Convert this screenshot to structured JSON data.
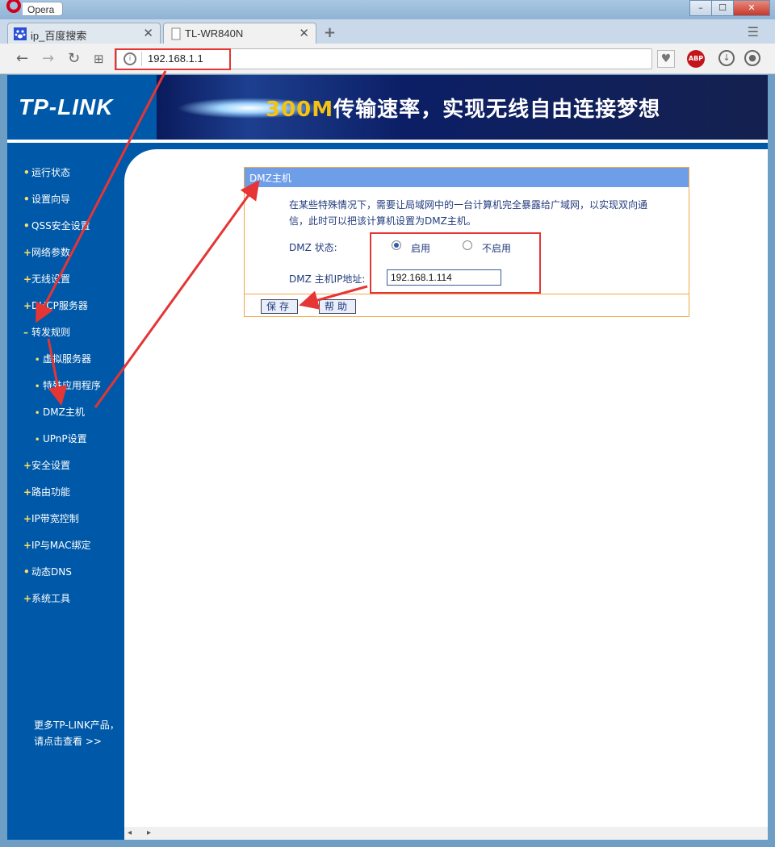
{
  "browser": {
    "app_name": "Opera",
    "tabs": [
      {
        "label": "ip_百度搜索",
        "close": "✕"
      },
      {
        "label": "TL-WR840N",
        "close": "✕"
      }
    ],
    "new_tab": "+",
    "tab_menu": "☰",
    "nav": {
      "back": "←",
      "forward": "→",
      "reload": "↻",
      "grid": "⊞"
    },
    "address": "192.168.1.1",
    "heart": "♥",
    "abp": "ABP",
    "download": "↓",
    "account": "●",
    "win": {
      "min": "–",
      "max": "☐",
      "close": "✕"
    }
  },
  "banner": {
    "logo": "TP-LINK",
    "slogan_highlight": "300M",
    "slogan_rest": "传输速率，实现无线自由连接梦想"
  },
  "sidebar": {
    "items": [
      {
        "label": "运行状态",
        "bullet": "•"
      },
      {
        "label": "设置向导",
        "bullet": "•"
      },
      {
        "label": "QSS安全设置",
        "bullet": "•"
      },
      {
        "label": "网络参数",
        "bullet": "+"
      },
      {
        "label": "无线设置",
        "bullet": "+"
      },
      {
        "label": "DHCP服务器",
        "bullet": "+"
      },
      {
        "label": "转发规则",
        "bullet": "–"
      },
      {
        "label": "虚拟服务器",
        "bullet": "•"
      },
      {
        "label": "特殊应用程序",
        "bullet": "•"
      },
      {
        "label": "DMZ主机",
        "bullet": "•"
      },
      {
        "label": "UPnP设置",
        "bullet": "•"
      },
      {
        "label": "安全设置",
        "bullet": "+"
      },
      {
        "label": "路由功能",
        "bullet": "+"
      },
      {
        "label": "IP带宽控制",
        "bullet": "+"
      },
      {
        "label": "IP与MAC绑定",
        "bullet": "+"
      },
      {
        "label": "动态DNS",
        "bullet": "•"
      },
      {
        "label": "系统工具",
        "bullet": "+"
      }
    ],
    "more_line1": "更多TP-LINK产品，",
    "more_line2": "请点击查看 >>"
  },
  "dmz": {
    "title": "DMZ主机",
    "description": "在某些特殊情况下，需要让局域网中的一台计算机完全暴露给广域网，以实现双向通信，此时可以把该计算机设置为DMZ主机。",
    "status_label": "DMZ 状态:",
    "enable_label": "启用",
    "disable_label": "不启用",
    "ip_label": "DMZ 主机IP地址:",
    "ip_value": "192.168.1.114",
    "save_label": "保存",
    "help_label": "帮助"
  },
  "scroll": {
    "left": "◂",
    "right": "▸"
  },
  "colors": {
    "sidebar": "#0059a8",
    "panel_head": "#6f9ee8",
    "panel_border": "#f3a64c",
    "annotation": "#e53535"
  }
}
